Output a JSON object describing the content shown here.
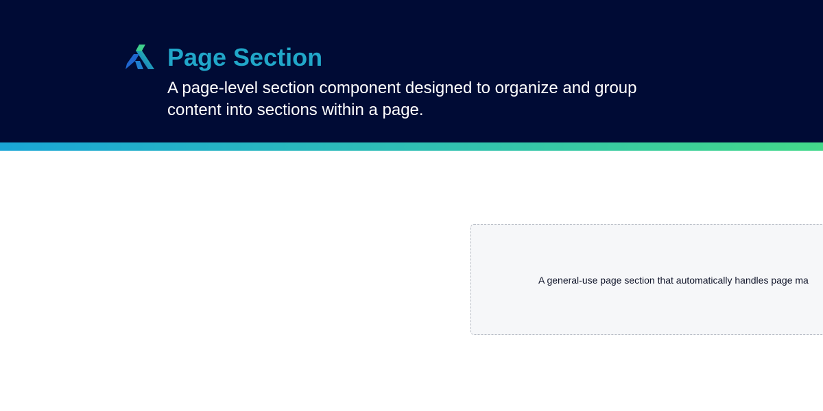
{
  "header": {
    "logo_icon": "gorilla-brand-icon",
    "title": "Page Section",
    "description": "A page-level section component designed to organize and group content into sections within a page.",
    "background_color": "#000b35",
    "title_color": "#21a7c9"
  },
  "accent_bar": {
    "gradient_start": "#1aa6d6",
    "gradient_end": "#43d98a"
  },
  "example": {
    "text": "A general-use page section that automatically handles page ma"
  }
}
